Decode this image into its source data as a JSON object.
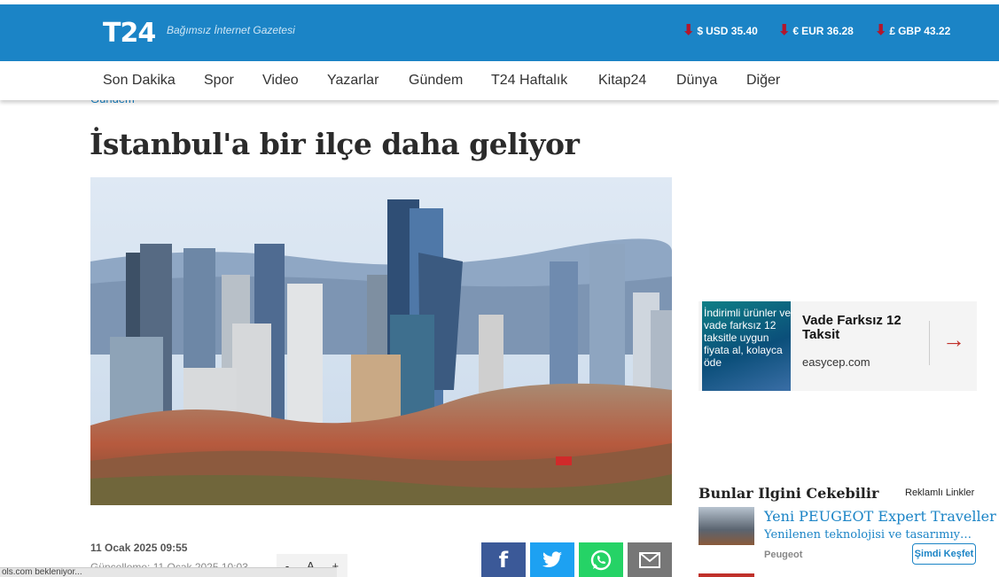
{
  "header": {
    "logo": "T24",
    "tagline": "Bağımsız İnternet Gazetesi",
    "currencies": [
      {
        "symbol": "$",
        "label": "USD 35.40"
      },
      {
        "symbol": "€",
        "label": "EUR 36.28"
      },
      {
        "symbol": "£",
        "label": "GBP 43.22"
      }
    ],
    "trend_icon": "arrow-down-icon",
    "trend_color": "#b3162c",
    "brand_color": "#1b84c6"
  },
  "nav": [
    "Son Dakika",
    "Spor",
    "Video",
    "Yazarlar",
    "Gündem",
    "T24 Haftalık",
    "Kitap24",
    "Dünya",
    "Diğer"
  ],
  "article": {
    "breadcrumb": "Gündem",
    "title": "İstanbul'a bir ilçe daha geliyor",
    "date": "11 Ocak 2025 09:55",
    "updated": "Güncelleme: 11 Ocak 2025 10:03",
    "font_controls": [
      "-",
      "A",
      "+"
    ]
  },
  "share": [
    {
      "icon": "facebook-icon",
      "glyph": "f",
      "color": "#3b5998"
    },
    {
      "icon": "twitter-icon",
      "glyph": "🐦",
      "color": "#1da1f2"
    },
    {
      "icon": "whatsapp-icon",
      "glyph": "✆",
      "color": "#25d366"
    },
    {
      "icon": "email-icon",
      "glyph": "✉",
      "color": "#777777"
    }
  ],
  "ad": {
    "image_text": "İndirimli ürünler ve vade farksız 12 taksitle uygun fiyata al, kolayca öde",
    "title": "Vade Farksız 12 Taksit",
    "domain": "easycep.com",
    "arrow": "→"
  },
  "recommendations": {
    "heading": "Bunlar Ilgini Cekebilir",
    "label": "Reklamlı Linkler",
    "items": [
      {
        "title": "Yeni PEUGEOT Expert Traveller",
        "desc": "Yenilenen teknolojisi ve tasarımıyla Peugeot",
        "brand": "Peugeot",
        "cta": "Şimdi Keşfet"
      }
    ]
  },
  "status": "ols.com bekleniyor..."
}
